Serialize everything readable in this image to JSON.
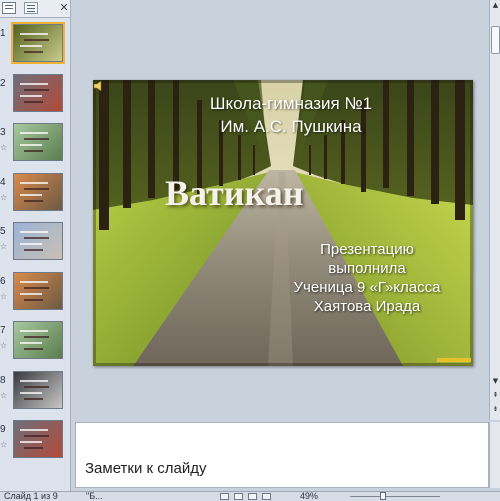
{
  "thumbnails": [
    {
      "number": "1",
      "selected": true,
      "has_star": false,
      "palette": "forest"
    },
    {
      "number": "2",
      "selected": false,
      "has_star": false,
      "palette": "red-gray"
    },
    {
      "number": "3",
      "selected": false,
      "has_star": true,
      "palette": "green-map"
    },
    {
      "number": "4",
      "selected": false,
      "has_star": true,
      "palette": "orange-photo"
    },
    {
      "number": "5",
      "selected": false,
      "has_star": true,
      "palette": "blue-building"
    },
    {
      "number": "6",
      "selected": false,
      "has_star": true,
      "palette": "orange-photo"
    },
    {
      "number": "7",
      "selected": false,
      "has_star": true,
      "palette": "green-map"
    },
    {
      "number": "8",
      "selected": false,
      "has_star": true,
      "palette": "dark-text"
    },
    {
      "number": "9",
      "selected": false,
      "has_star": true,
      "palette": "red-gray"
    }
  ],
  "star_glyph": "☆",
  "slide": {
    "school_line1": "Школа-гимназия №1",
    "school_line2": "Им. А.С. Пушкина",
    "title": "Ватикан",
    "author_lines": [
      "Презентацию",
      "выполнила",
      "Ученица 9 «Г»класса",
      "Хаятова Ирада"
    ]
  },
  "notes": {
    "placeholder": "Заметки к слайду"
  },
  "status_bar": {
    "slide_info": "Слайд 1 из 9",
    "theme": "\"Б...",
    "zoom": "49%"
  },
  "colors": {
    "selection": "#f2b233",
    "window_bg": "#c9d1dc",
    "sky": "#f2efd9",
    "foliage_dark": "#2e3a14",
    "grass": "#9fb934",
    "road": "#8a8375"
  }
}
